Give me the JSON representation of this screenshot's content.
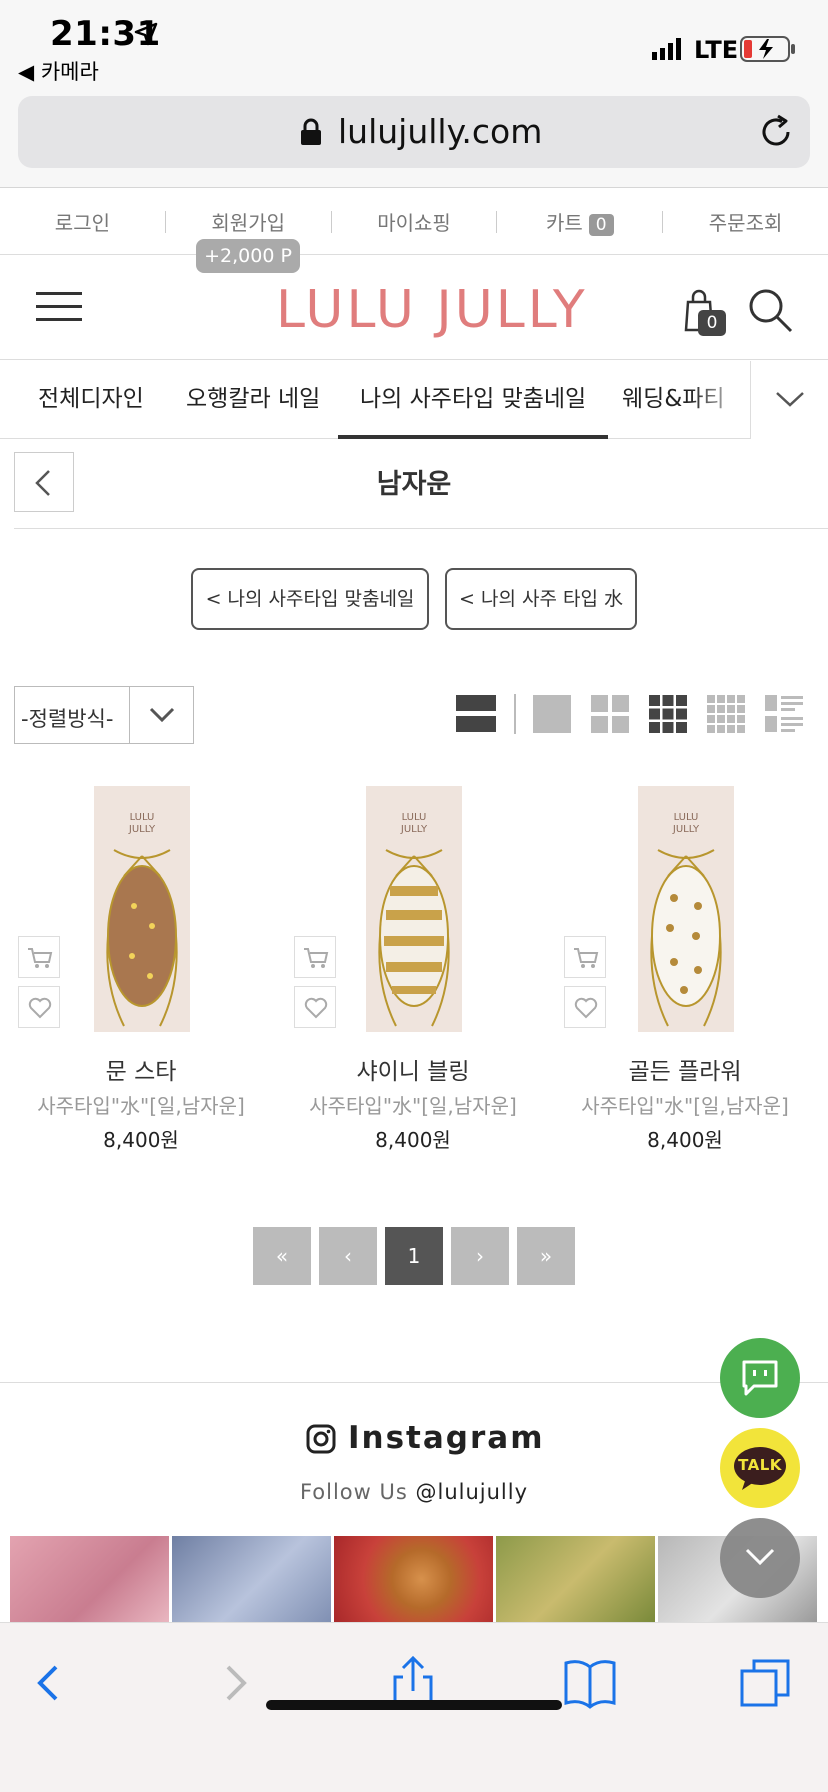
{
  "status_bar": {
    "time": "21:31",
    "back_app": "◀ 카메라",
    "network": "LTE"
  },
  "browser": {
    "url": "lulujully.com"
  },
  "top_links": {
    "login": "로그인",
    "signup": "회원가입",
    "my_shopping": "마이쇼핑",
    "cart": "카트",
    "cart_count": "0",
    "order_lookup": "주문조회",
    "signup_point": "+2,000 P"
  },
  "header": {
    "logo": "LULU JULLY",
    "bag_count": "0"
  },
  "category_nav": {
    "items": [
      "전체디자인",
      "오행칼라 네일",
      "나의 사주타입 맞춤네일",
      "웨딩&파티"
    ],
    "active_index": 2
  },
  "page": {
    "title": "남자운",
    "breadcrumbs": [
      "< 나의 사주타입 맞춤네일",
      "< 나의 사주 타입 水"
    ]
  },
  "toolbar": {
    "sort_label": "-정렬방식-"
  },
  "products": [
    {
      "name": "문 스타",
      "type": "사주타입\"水\"[일,남자운]",
      "price": "8,400원"
    },
    {
      "name": "샤이니 블링",
      "type": "사주타입\"水\"[일,남자운]",
      "price": "8,400원"
    },
    {
      "name": "골든 플라워",
      "type": "사주타입\"水\"[일,남자운]",
      "price": "8,400원"
    }
  ],
  "pagination": {
    "first": "«",
    "prev": "‹",
    "current": "1",
    "next": "›",
    "last": "»"
  },
  "instagram": {
    "title": "Instagram",
    "follow_prefix": "Follow Us",
    "handle": "@lulujully"
  },
  "floating": {
    "talk_label": "TALK"
  },
  "colors": {
    "logo": "#e07d7d",
    "chat_green": "#4caf50",
    "kakao_yellow": "#f2e43a",
    "safari_blue": "#1a73e8"
  }
}
